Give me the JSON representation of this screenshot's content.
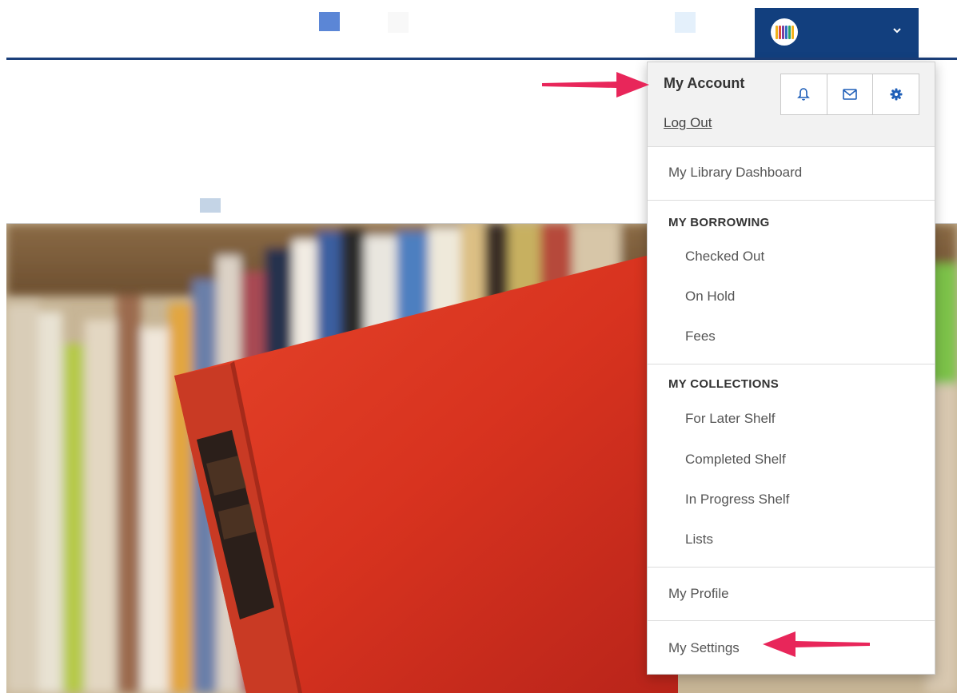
{
  "account_menu": {
    "header": {
      "title": "My Account",
      "logout_label": "Log Out"
    },
    "icons": [
      "bell-icon",
      "mail-icon",
      "gear-icon"
    ],
    "dashboard_label": "My Library Dashboard",
    "borrowing": {
      "heading": "MY BORROWING",
      "items": [
        "Checked Out",
        "On Hold",
        "Fees"
      ]
    },
    "collections": {
      "heading": "MY COLLECTIONS",
      "items": [
        "For Later Shelf",
        "Completed Shelf",
        "In Progress Shelf",
        "Lists"
      ]
    },
    "profile_label": "My Profile",
    "settings_label": "My Settings"
  },
  "colors": {
    "brand_navy": "#123f7e",
    "annotation_arrow": "#e8265a",
    "icon_blue": "#1f5fb8"
  }
}
